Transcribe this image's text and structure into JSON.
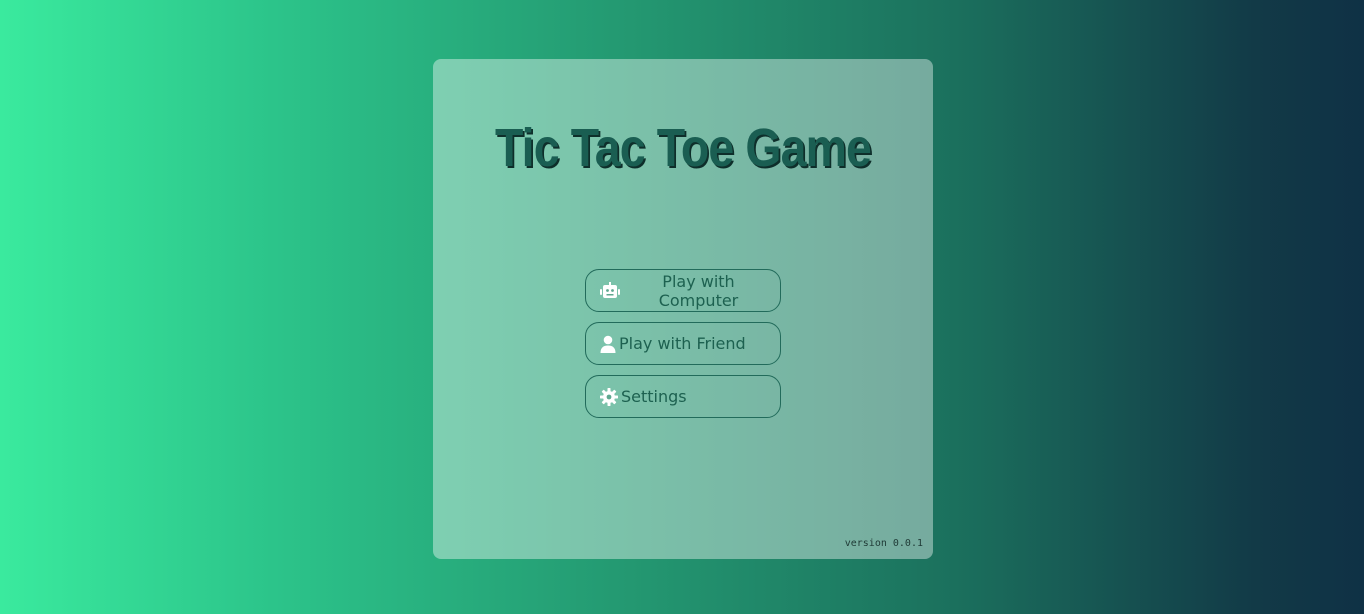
{
  "title": "Tic Tac Toe Game",
  "menu": {
    "items": [
      {
        "label": "Play with Computer",
        "icon": "robot-icon"
      },
      {
        "label": "Play with Friend",
        "icon": "user-icon"
      },
      {
        "label": "Settings",
        "icon": "gear-icon"
      }
    ]
  },
  "footer": {
    "version": "version 0.0.1"
  },
  "colors": {
    "title": "#1a5e52",
    "button_text": "#1d6150",
    "button_border": "#226b5b",
    "gradient_start": "#3aea9e",
    "gradient_end": "#0f3145"
  }
}
